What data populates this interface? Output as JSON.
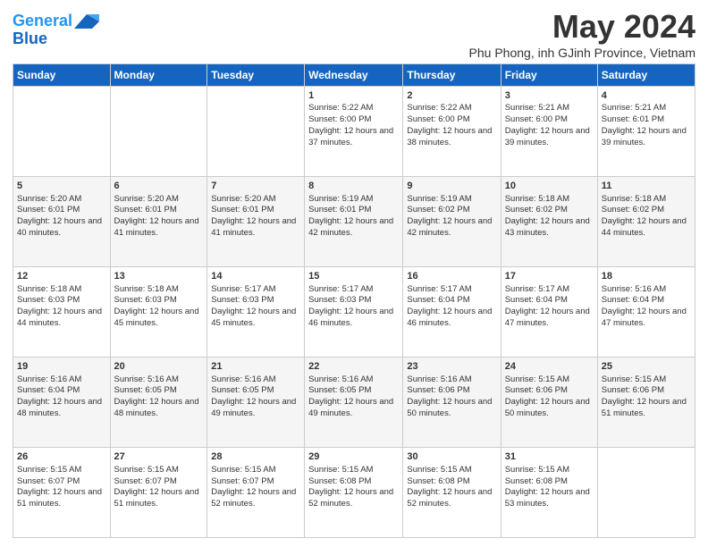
{
  "header": {
    "logo_line1": "General",
    "logo_line2": "Blue",
    "month": "May 2024",
    "location": "Phu Phong, inh GJinh Province, Vietnam"
  },
  "weekdays": [
    "Sunday",
    "Monday",
    "Tuesday",
    "Wednesday",
    "Thursday",
    "Friday",
    "Saturday"
  ],
  "weeks": [
    [
      {
        "day": "",
        "sunrise": "",
        "sunset": "",
        "daylight": ""
      },
      {
        "day": "",
        "sunrise": "",
        "sunset": "",
        "daylight": ""
      },
      {
        "day": "",
        "sunrise": "",
        "sunset": "",
        "daylight": ""
      },
      {
        "day": "1",
        "sunrise": "Sunrise: 5:22 AM",
        "sunset": "Sunset: 6:00 PM",
        "daylight": "Daylight: 12 hours and 37 minutes."
      },
      {
        "day": "2",
        "sunrise": "Sunrise: 5:22 AM",
        "sunset": "Sunset: 6:00 PM",
        "daylight": "Daylight: 12 hours and 38 minutes."
      },
      {
        "day": "3",
        "sunrise": "Sunrise: 5:21 AM",
        "sunset": "Sunset: 6:00 PM",
        "daylight": "Daylight: 12 hours and 39 minutes."
      },
      {
        "day": "4",
        "sunrise": "Sunrise: 5:21 AM",
        "sunset": "Sunset: 6:01 PM",
        "daylight": "Daylight: 12 hours and 39 minutes."
      }
    ],
    [
      {
        "day": "5",
        "sunrise": "Sunrise: 5:20 AM",
        "sunset": "Sunset: 6:01 PM",
        "daylight": "Daylight: 12 hours and 40 minutes."
      },
      {
        "day": "6",
        "sunrise": "Sunrise: 5:20 AM",
        "sunset": "Sunset: 6:01 PM",
        "daylight": "Daylight: 12 hours and 41 minutes."
      },
      {
        "day": "7",
        "sunrise": "Sunrise: 5:20 AM",
        "sunset": "Sunset: 6:01 PM",
        "daylight": "Daylight: 12 hours and 41 minutes."
      },
      {
        "day": "8",
        "sunrise": "Sunrise: 5:19 AM",
        "sunset": "Sunset: 6:01 PM",
        "daylight": "Daylight: 12 hours and 42 minutes."
      },
      {
        "day": "9",
        "sunrise": "Sunrise: 5:19 AM",
        "sunset": "Sunset: 6:02 PM",
        "daylight": "Daylight: 12 hours and 42 minutes."
      },
      {
        "day": "10",
        "sunrise": "Sunrise: 5:18 AM",
        "sunset": "Sunset: 6:02 PM",
        "daylight": "Daylight: 12 hours and 43 minutes."
      },
      {
        "day": "11",
        "sunrise": "Sunrise: 5:18 AM",
        "sunset": "Sunset: 6:02 PM",
        "daylight": "Daylight: 12 hours and 44 minutes."
      }
    ],
    [
      {
        "day": "12",
        "sunrise": "Sunrise: 5:18 AM",
        "sunset": "Sunset: 6:03 PM",
        "daylight": "Daylight: 12 hours and 44 minutes."
      },
      {
        "day": "13",
        "sunrise": "Sunrise: 5:18 AM",
        "sunset": "Sunset: 6:03 PM",
        "daylight": "Daylight: 12 hours and 45 minutes."
      },
      {
        "day": "14",
        "sunrise": "Sunrise: 5:17 AM",
        "sunset": "Sunset: 6:03 PM",
        "daylight": "Daylight: 12 hours and 45 minutes."
      },
      {
        "day": "15",
        "sunrise": "Sunrise: 5:17 AM",
        "sunset": "Sunset: 6:03 PM",
        "daylight": "Daylight: 12 hours and 46 minutes."
      },
      {
        "day": "16",
        "sunrise": "Sunrise: 5:17 AM",
        "sunset": "Sunset: 6:04 PM",
        "daylight": "Daylight: 12 hours and 46 minutes."
      },
      {
        "day": "17",
        "sunrise": "Sunrise: 5:17 AM",
        "sunset": "Sunset: 6:04 PM",
        "daylight": "Daylight: 12 hours and 47 minutes."
      },
      {
        "day": "18",
        "sunrise": "Sunrise: 5:16 AM",
        "sunset": "Sunset: 6:04 PM",
        "daylight": "Daylight: 12 hours and 47 minutes."
      }
    ],
    [
      {
        "day": "19",
        "sunrise": "Sunrise: 5:16 AM",
        "sunset": "Sunset: 6:04 PM",
        "daylight": "Daylight: 12 hours and 48 minutes."
      },
      {
        "day": "20",
        "sunrise": "Sunrise: 5:16 AM",
        "sunset": "Sunset: 6:05 PM",
        "daylight": "Daylight: 12 hours and 48 minutes."
      },
      {
        "day": "21",
        "sunrise": "Sunrise: 5:16 AM",
        "sunset": "Sunset: 6:05 PM",
        "daylight": "Daylight: 12 hours and 49 minutes."
      },
      {
        "day": "22",
        "sunrise": "Sunrise: 5:16 AM",
        "sunset": "Sunset: 6:05 PM",
        "daylight": "Daylight: 12 hours and 49 minutes."
      },
      {
        "day": "23",
        "sunrise": "Sunrise: 5:16 AM",
        "sunset": "Sunset: 6:06 PM",
        "daylight": "Daylight: 12 hours and 50 minutes."
      },
      {
        "day": "24",
        "sunrise": "Sunrise: 5:15 AM",
        "sunset": "Sunset: 6:06 PM",
        "daylight": "Daylight: 12 hours and 50 minutes."
      },
      {
        "day": "25",
        "sunrise": "Sunrise: 5:15 AM",
        "sunset": "Sunset: 6:06 PM",
        "daylight": "Daylight: 12 hours and 51 minutes."
      }
    ],
    [
      {
        "day": "26",
        "sunrise": "Sunrise: 5:15 AM",
        "sunset": "Sunset: 6:07 PM",
        "daylight": "Daylight: 12 hours and 51 minutes."
      },
      {
        "day": "27",
        "sunrise": "Sunrise: 5:15 AM",
        "sunset": "Sunset: 6:07 PM",
        "daylight": "Daylight: 12 hours and 51 minutes."
      },
      {
        "day": "28",
        "sunrise": "Sunrise: 5:15 AM",
        "sunset": "Sunset: 6:07 PM",
        "daylight": "Daylight: 12 hours and 52 minutes."
      },
      {
        "day": "29",
        "sunrise": "Sunrise: 5:15 AM",
        "sunset": "Sunset: 6:08 PM",
        "daylight": "Daylight: 12 hours and 52 minutes."
      },
      {
        "day": "30",
        "sunrise": "Sunrise: 5:15 AM",
        "sunset": "Sunset: 6:08 PM",
        "daylight": "Daylight: 12 hours and 52 minutes."
      },
      {
        "day": "31",
        "sunrise": "Sunrise: 5:15 AM",
        "sunset": "Sunset: 6:08 PM",
        "daylight": "Daylight: 12 hours and 53 minutes."
      },
      {
        "day": "",
        "sunrise": "",
        "sunset": "",
        "daylight": ""
      }
    ]
  ]
}
